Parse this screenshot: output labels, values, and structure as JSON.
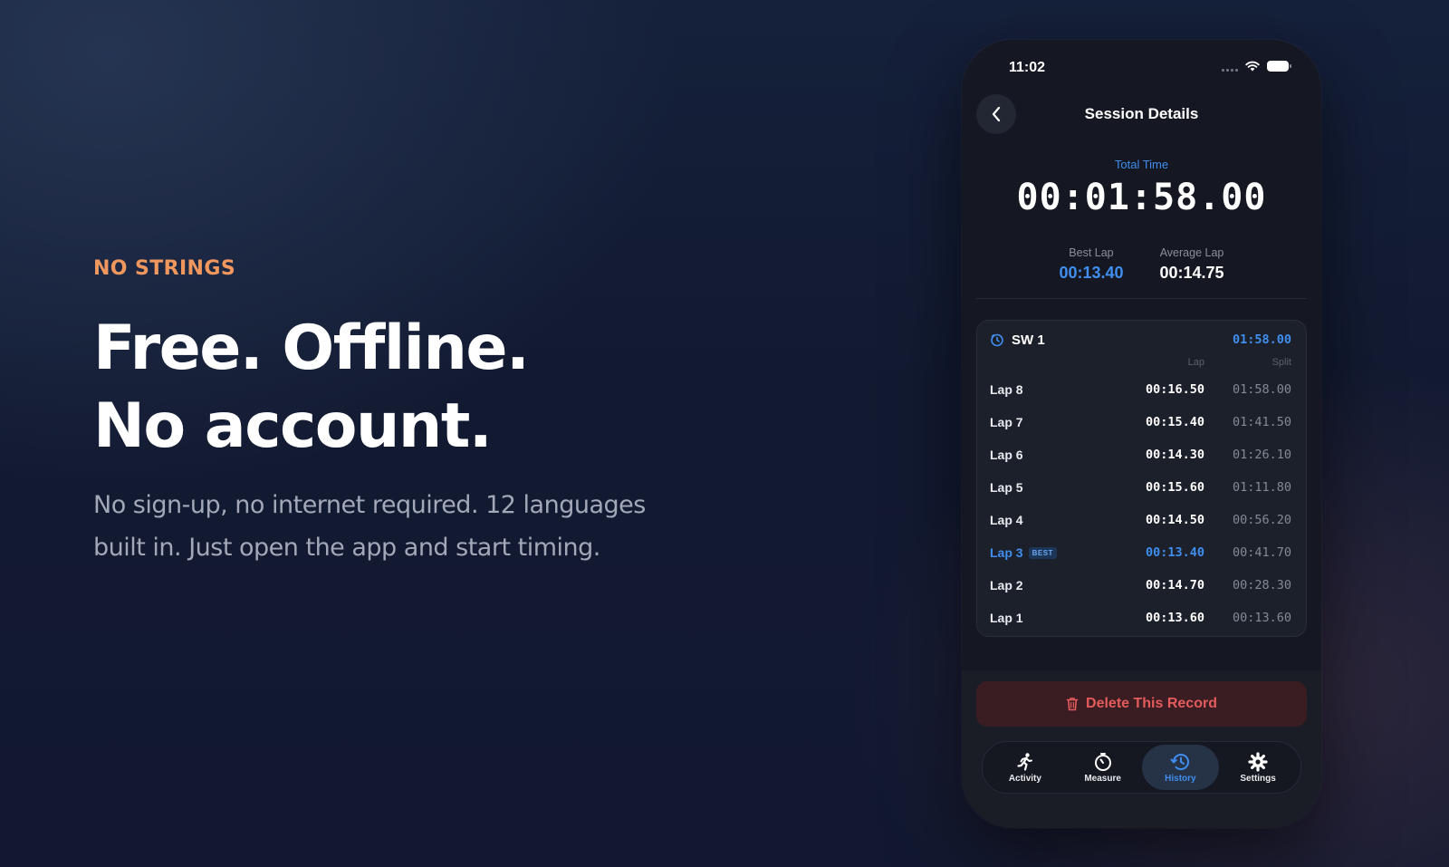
{
  "marketing": {
    "eyebrow": "NO STRINGS",
    "headline_lines": [
      "Free. Offline.",
      "No account."
    ],
    "subcopy_lines": [
      "No sign-up, no internet required. 12 languages",
      "built in. Just open the app and start timing."
    ]
  },
  "phone": {
    "status_bar": {
      "time": "11:02"
    },
    "header": {
      "title": "Session Details",
      "back_icon": "chevron-left-icon"
    },
    "summary": {
      "total_label": "Total Time",
      "total_value": "00:01:58.00",
      "best_lap_label": "Best Lap",
      "best_lap_value": "00:13.40",
      "average_lap_label": "Average Lap",
      "average_lap_value": "00:14.75"
    },
    "stopwatch": {
      "name": "SW 1",
      "total": "01:58.00",
      "col_lap": "Lap",
      "col_split": "Split",
      "best_badge": "BEST",
      "laps": [
        {
          "name": "Lap 8",
          "lap": "00:16.50",
          "split": "01:58.00",
          "best": false
        },
        {
          "name": "Lap 7",
          "lap": "00:15.40",
          "split": "01:41.50",
          "best": false
        },
        {
          "name": "Lap 6",
          "lap": "00:14.30",
          "split": "01:26.10",
          "best": false
        },
        {
          "name": "Lap 5",
          "lap": "00:15.60",
          "split": "01:11.80",
          "best": false
        },
        {
          "name": "Lap 4",
          "lap": "00:14.50",
          "split": "00:56.20",
          "best": false
        },
        {
          "name": "Lap 3",
          "lap": "00:13.40",
          "split": "00:41.70",
          "best": true
        },
        {
          "name": "Lap 2",
          "lap": "00:14.70",
          "split": "00:28.30",
          "best": false
        },
        {
          "name": "Lap 1",
          "lap": "00:13.60",
          "split": "00:13.60",
          "best": false
        }
      ]
    },
    "delete_label": "Delete This Record",
    "tabs": [
      {
        "label": "Activity",
        "icon": "runner-icon",
        "active": false
      },
      {
        "label": "Measure",
        "icon": "stopwatch-icon",
        "active": false
      },
      {
        "label": "History",
        "icon": "history-clock-icon",
        "active": true
      },
      {
        "label": "Settings",
        "icon": "gear-icon",
        "active": false
      }
    ]
  },
  "colors": {
    "accent": "#3f8ef0",
    "eyebrow": "#f0975d",
    "danger": "#e45b5b",
    "background": "#131b33"
  }
}
